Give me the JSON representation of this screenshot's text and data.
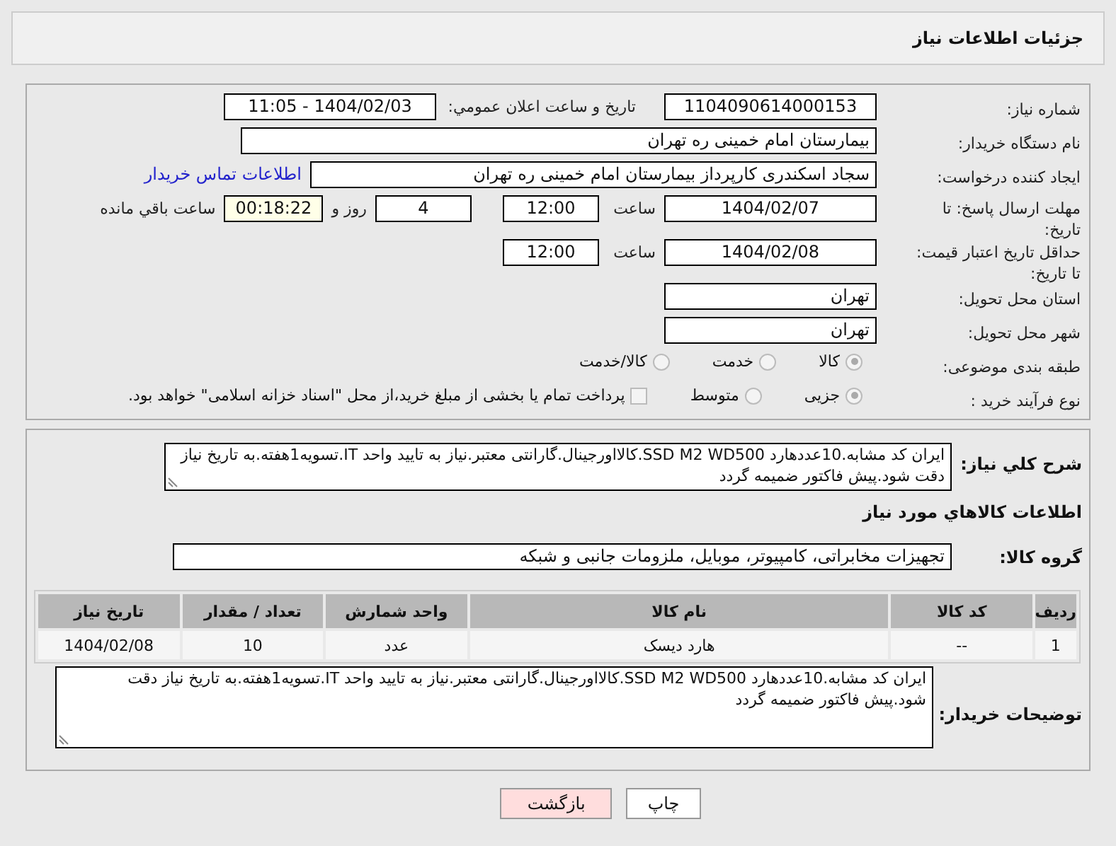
{
  "header": {
    "title": "جزئیات اطلاعات نیاز"
  },
  "need_number": {
    "label": "شماره نیاز:",
    "value": "1104090614000153"
  },
  "announce": {
    "label": "تاریخ و ساعت اعلان عمومي:",
    "value": "1404/02/03 - 11:05"
  },
  "buyer_org": {
    "label": "نام دستگاه خریدار:",
    "value": "بیمارستان امام خمینی ره  تهران"
  },
  "creator": {
    "label": "ایجاد کننده درخواست:",
    "value": "سجاد اسکندری کارپرداز بیمارستان امام خمینی ره  تهران",
    "link": "اطلاعات تماس خریدار"
  },
  "deadline": {
    "label": "مهلت ارسال پاسخ: تا تاریخ:",
    "date": "1404/02/07",
    "time_label": "ساعت",
    "time": "12:00",
    "days": "4",
    "days_label": "روز و",
    "remaining": "00:18:22",
    "remaining_label": "ساعت باقي مانده"
  },
  "price_validity": {
    "label": "حداقل تاریخ اعتبار قیمت: تا تاریخ:",
    "date": "1404/02/08",
    "time_label": "ساعت",
    "time": "12:00"
  },
  "province": {
    "label": "استان محل تحویل:",
    "value": "تهران"
  },
  "city": {
    "label": "شهر محل تحویل:",
    "value": "تهران"
  },
  "category": {
    "label": "طبقه بندی موضوعی:",
    "options": [
      {
        "label": "کالا",
        "selected": true
      },
      {
        "label": "خدمت",
        "selected": false
      },
      {
        "label": "کالا/خدمت",
        "selected": false
      }
    ]
  },
  "purchase_process": {
    "label": "نوع فرآیند خرید :",
    "options": [
      {
        "label": "جزیی",
        "selected": true
      },
      {
        "label": "متوسط",
        "selected": false
      }
    ],
    "payment": {
      "checked": false,
      "text": "پرداخت تمام یا بخشی از مبلغ خرید،از محل \"اسناد خزانه اسلامی\" خواهد بود."
    }
  },
  "description": {
    "label": "شرح کلي نیاز:",
    "value": "ایران کد مشابه.10عددهارد SSD M2 WD500.کالااورجینال.گارانتی معتبر.نیاز به تایید واحد IT.تسویه1هفته.به تاریخ نیاز دقت شود.پیش فاکتور ضمیمه گردد"
  },
  "goods_title": "اطلاعات کالاهاي مورد نیاز",
  "goods_group": {
    "label": "گروه کالا:",
    "value": "تجهیزات مخابراتی، کامپیوتر، موبایل، ملزومات جانبی و شبکه"
  },
  "table": {
    "columns": [
      "ردیف",
      "کد کالا",
      "نام کالا",
      "واحد شمارش",
      "تعداد / مقدار",
      "تاریخ نیاز"
    ],
    "rows": [
      [
        "1",
        "--",
        "هارد دیسک",
        "عدد",
        "10",
        "1404/02/08"
      ]
    ]
  },
  "buyer_notes": {
    "label": "توضیحات خریدار:",
    "value": "ایران کد مشابه.10عددهارد SSD M2 WD500.کالااورجینال.گارانتی معتبر.نیاز به تایید واحد IT.تسویه1هفته.به تاریخ نیاز دقت شود.پیش فاکتور ضمیمه گردد"
  },
  "buttons": [
    {
      "label": "چاپ",
      "kind": "print"
    },
    {
      "label": "بازگشت",
      "kind": "back"
    }
  ]
}
